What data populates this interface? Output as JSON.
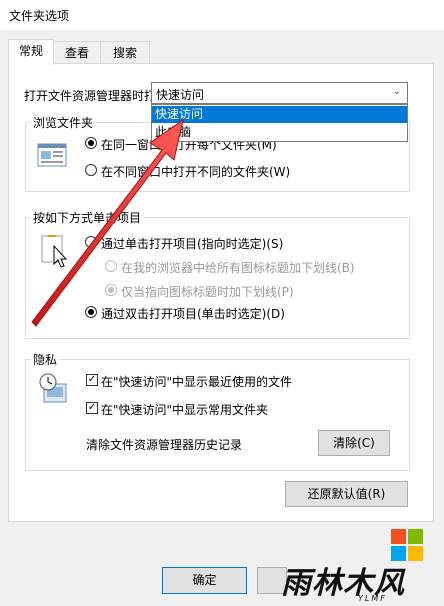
{
  "window": {
    "title": "文件夹选项"
  },
  "tabs": [
    {
      "label": "常规",
      "active": true
    },
    {
      "label": "查看",
      "active": false
    },
    {
      "label": "搜索",
      "active": false
    }
  ],
  "open_explorer": {
    "label": "打开文件资源管理器时打",
    "selected": "快速访问",
    "options": [
      "快速访问",
      "此电脑"
    ]
  },
  "browse_folders": {
    "title": "浏览文件夹",
    "options": [
      {
        "label": "在同一窗口中打开每个文件夹(M)",
        "checked": true
      },
      {
        "label": "在不同窗口中打开不同的文件夹(W)",
        "checked": false
      }
    ]
  },
  "click_items": {
    "title": "按如下方式单击项目",
    "options": [
      {
        "label": "通过单击打开项目(指向时选定)(S)",
        "checked": false,
        "enabled": true
      },
      {
        "label": "在我的浏览器中给所有图标标题加下划线(B)",
        "checked": false,
        "enabled": false
      },
      {
        "label": "仅当指向图标标题时加下划线(P)",
        "checked": true,
        "enabled": false
      },
      {
        "label": "通过双击打开项目(单击时选定)(D)",
        "checked": true,
        "enabled": true
      }
    ]
  },
  "privacy": {
    "title": "隐私",
    "checks": [
      {
        "label": "在\"快速访问\"中显示最近使用的文件",
        "checked": true
      },
      {
        "label": "在\"快速访问\"中显示常用文件夹",
        "checked": true
      }
    ],
    "clear_label": "清除文件资源管理器历史记录",
    "clear_button": "清除(C)"
  },
  "restore_button": "还原默认值(R)",
  "footer": {
    "ok_button": "确定"
  },
  "watermark": {
    "text": "雨林木风",
    "sub": "YLMF"
  },
  "colors": {
    "highlight": "#0078d7",
    "arrow": "#e03030"
  }
}
